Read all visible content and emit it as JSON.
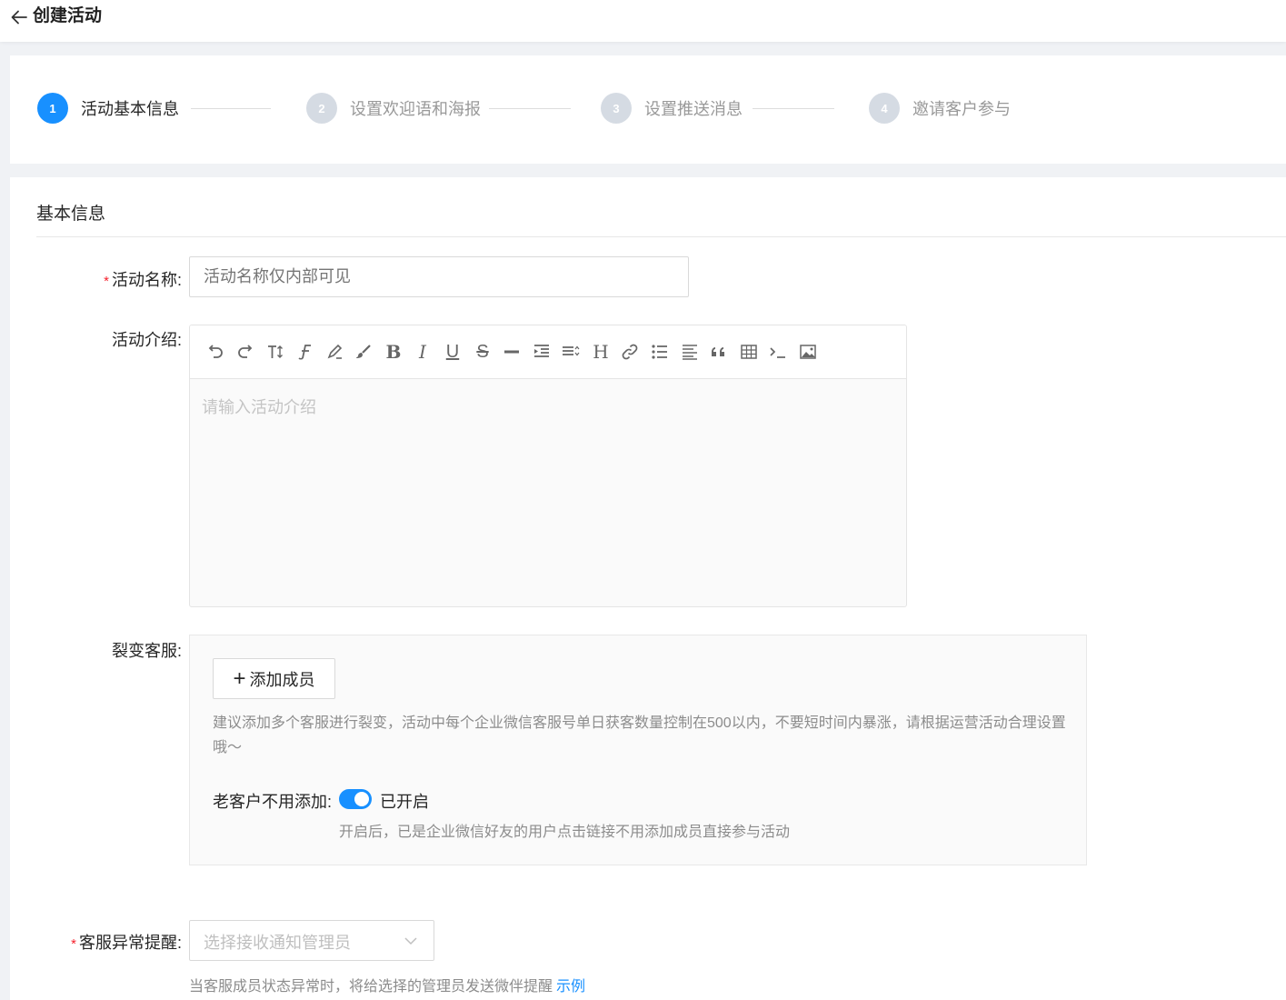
{
  "header": {
    "title": "创建活动",
    "back_icon": "arrow-left-icon"
  },
  "steps": [
    {
      "num": "1",
      "label": "活动基本信息",
      "active": true
    },
    {
      "num": "2",
      "label": "设置欢迎语和海报",
      "active": false
    },
    {
      "num": "3",
      "label": "设置推送消息",
      "active": false
    },
    {
      "num": "4",
      "label": "邀请客户参与",
      "active": false
    }
  ],
  "basic": {
    "section_title": "基本信息",
    "activity_name": {
      "label": "活动名称:",
      "value": "",
      "placeholder": "活动名称仅内部可见"
    },
    "activity_intro": {
      "label": "活动介绍:",
      "placeholder": "请输入活动介绍",
      "toolbar": [
        "undo-icon",
        "redo-icon",
        "font-size-icon",
        "font-family-icon",
        "highlight-icon",
        "brush-icon",
        "bold-icon",
        "italic-icon",
        "underline-icon",
        "strikethrough-icon",
        "horizontal-rule-icon",
        "indent-icon",
        "line-height-icon",
        "heading-icon",
        "link-icon",
        "bullet-list-icon",
        "align-icon",
        "quote-icon",
        "table-icon",
        "code-icon",
        "image-icon"
      ]
    },
    "service": {
      "label": "裂变客服:",
      "add_button": "添加成员",
      "hint": "建议添加多个客服进行裂变，活动中每个企业微信客服号单日获客数量控制在500以内，不要短时间内暴涨，请根据运营活动合理设置哦～",
      "toggle_label": "老客户不用添加:",
      "toggle_on": true,
      "toggle_text": "已开启",
      "toggle_hint": "开启后，已是企业微信好友的用户点击链接不用添加成员直接参与活动"
    },
    "alert": {
      "label": "客服异常提醒:",
      "placeholder": "选择接收通知管理员",
      "hint": "当客服成员状态异常时，将给选择的管理员发送微伴提醒",
      "example_link": "示例"
    }
  },
  "colors": {
    "primary": "#1890ff",
    "required": "#f5222d",
    "step_inactive": "#d5dbe3"
  }
}
